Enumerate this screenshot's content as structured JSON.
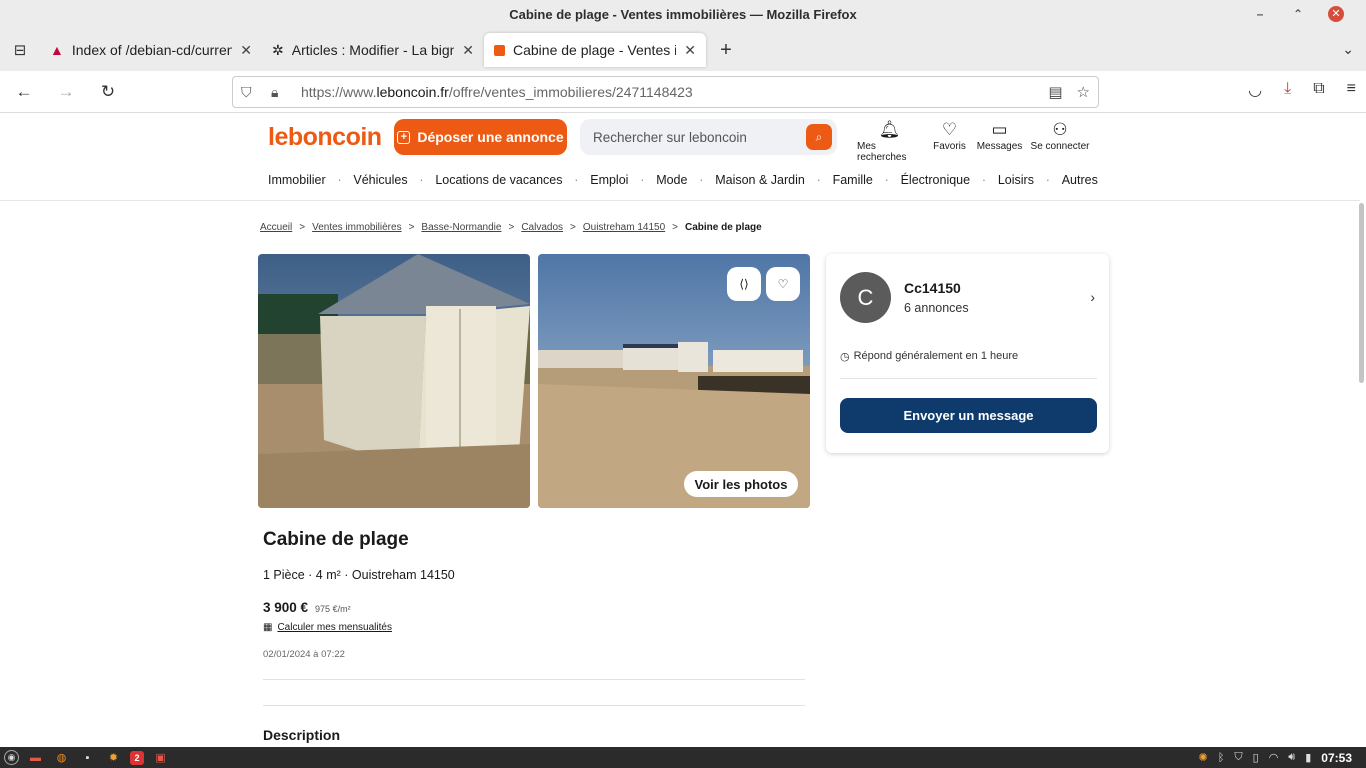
{
  "window": {
    "title": "Cabine de plage - Ventes immobilières — Mozilla Firefox"
  },
  "tabs": [
    {
      "label": "Index of /debian-cd/current",
      "icon": "debian-icon"
    },
    {
      "label": "Articles : Modifier - La bignonne",
      "icon": "joomla-icon"
    },
    {
      "label": "Cabine de plage - Ventes immobilières",
      "icon": "leboncoin-icon",
      "active": true
    }
  ],
  "urlbar": {
    "prefix": "https://www.",
    "domain": "leboncoin.fr",
    "path": "/offre/ventes_immobilieres/2471148423"
  },
  "site": {
    "logo": "leboncoin",
    "deposer_label": "Déposer une annonce",
    "search_placeholder": "Rechercher sur leboncoin",
    "header_icons": [
      {
        "label": "Mes recherches",
        "icon": "bell-icon"
      },
      {
        "label": "Favoris",
        "icon": "heart-icon"
      },
      {
        "label": "Messages",
        "icon": "message-icon"
      },
      {
        "label": "Se connecter",
        "icon": "user-icon"
      }
    ],
    "categories": [
      "Immobilier",
      "Véhicules",
      "Locations de vacances",
      "Emploi",
      "Mode",
      "Maison & Jardin",
      "Famille",
      "Électronique",
      "Loisirs",
      "Autres"
    ],
    "accent_color": "#ec5a13",
    "primary_button_color": "#0e3b6b"
  },
  "breadcrumb": [
    "Accueil",
    "Ventes immobilières",
    "Basse-Normandie",
    "Calvados",
    "Ouistreham 14150",
    "Cabine de plage"
  ],
  "ad": {
    "voir_photos": "Voir les photos",
    "title": "Cabine de plage",
    "subtitle": "1 Pièce · 4 m² · Ouistreham 14150",
    "price": "3 900 €",
    "price_per_m2": "975 €/m²",
    "calc_label": "Calculer mes mensualités",
    "date": "02/01/2024 à 07:22",
    "description_heading": "Description"
  },
  "seller": {
    "initial": "C",
    "name": "Cc14150",
    "ads_count": "6 annonces",
    "response": "Répond généralement en 1 heure",
    "button_label": "Envoyer un message"
  },
  "taskbar": {
    "badge": "2",
    "clock": "07:53"
  }
}
